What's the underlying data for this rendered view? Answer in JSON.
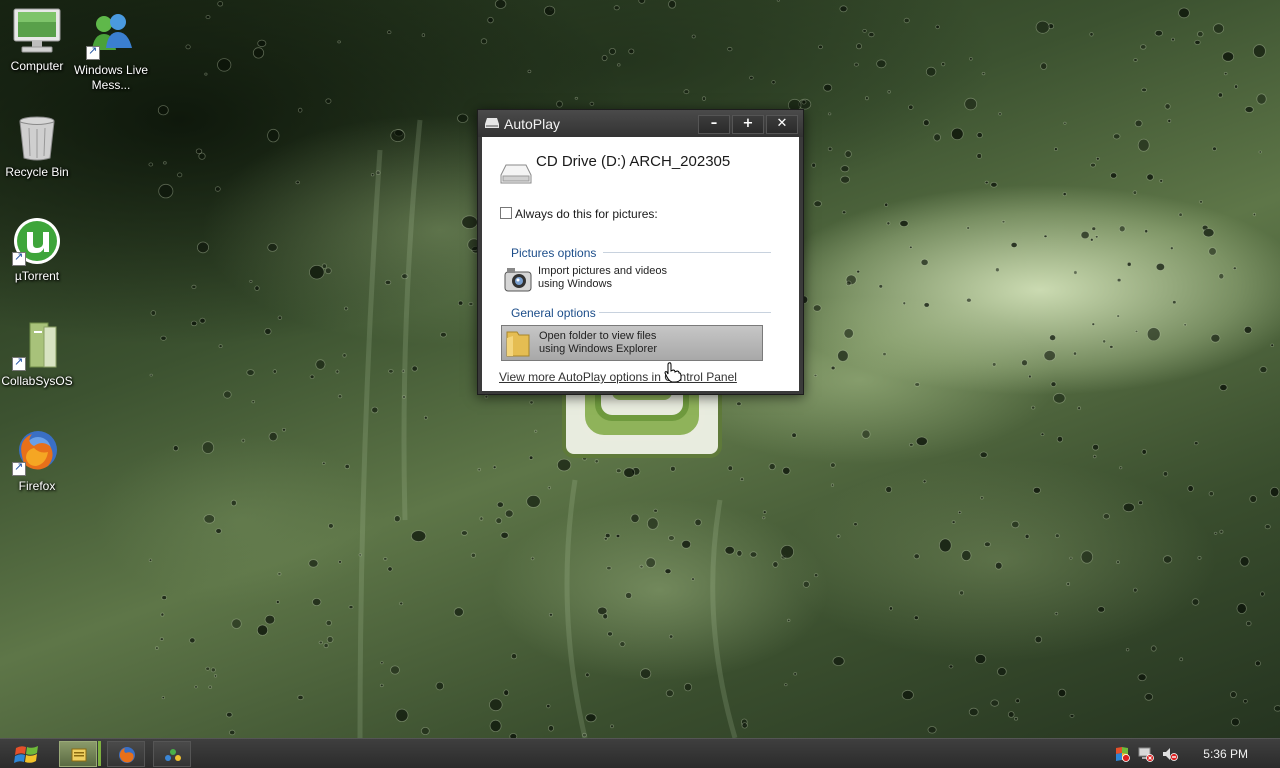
{
  "desktop": {
    "icons": [
      {
        "label": "Computer"
      },
      {
        "label": "Windows Live Mess..."
      },
      {
        "label": "Recycle Bin"
      },
      {
        "label": "µTorrent"
      },
      {
        "label": "CollabSysOS"
      },
      {
        "label": "Firefox"
      }
    ]
  },
  "autoplay": {
    "title": "AutoPlay",
    "buttons": {
      "minimize": "–",
      "maximize": "+",
      "close": "✕"
    },
    "drive_title": "CD Drive (D:) ARCH_202305",
    "always_label": "Always do this for pictures:",
    "always_checked": false,
    "sections": [
      {
        "header": "Pictures options",
        "options": [
          {
            "line1": "Import pictures and videos",
            "line2": "using Windows",
            "icon": "camera-icon"
          }
        ]
      },
      {
        "header": "General options",
        "options": [
          {
            "line1": "Open folder to view files",
            "line2": "using Windows Explorer",
            "icon": "folder-icon",
            "highlighted": true
          }
        ]
      }
    ],
    "control_panel_link": "View more AutoPlay options in Control Panel"
  },
  "taskbar": {
    "clock": "5:36 PM"
  },
  "colors": {
    "section_header": "#1d4e8a",
    "title_bar": "#3a3a3a",
    "highlight": "#b4b4b4"
  }
}
